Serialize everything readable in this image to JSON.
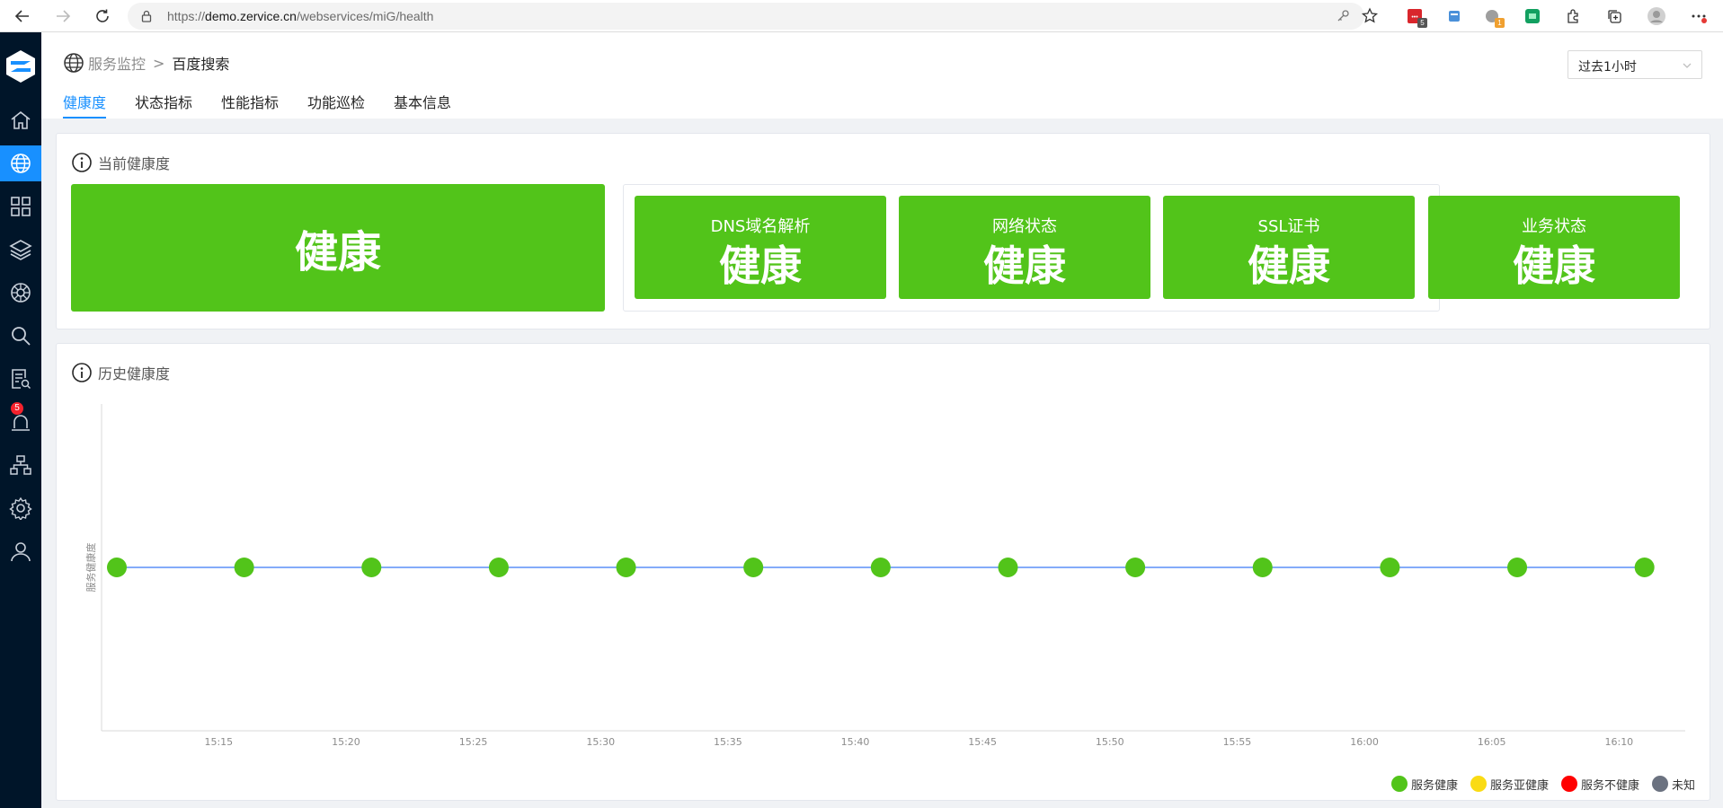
{
  "browser": {
    "url_prefix": "https://",
    "url_host": "demo.zervice.cn",
    "url_path": "/webservices/miG/health",
    "extension_badges": [
      "5",
      "1"
    ]
  },
  "sidebar": {
    "items": [
      {
        "name": "home",
        "icon": "home-icon",
        "active": false
      },
      {
        "name": "service-monitor",
        "icon": "globe-icon",
        "active": true
      },
      {
        "name": "apps",
        "icon": "grid-icon",
        "active": false
      },
      {
        "name": "layers",
        "icon": "layers-icon",
        "active": false
      },
      {
        "name": "cluster",
        "icon": "helm-icon",
        "active": false
      },
      {
        "name": "search",
        "icon": "search-icon",
        "active": false
      },
      {
        "name": "logs",
        "icon": "log-search-icon",
        "active": false
      },
      {
        "name": "alerts",
        "icon": "alarm-icon",
        "active": false,
        "badge": "5"
      },
      {
        "name": "topology",
        "icon": "topology-icon",
        "active": false
      },
      {
        "name": "settings",
        "icon": "gear-icon",
        "active": false
      },
      {
        "name": "user",
        "icon": "user-icon",
        "active": false
      }
    ]
  },
  "header": {
    "breadcrumb_parent": "服务监控",
    "breadcrumb_separator": ">",
    "breadcrumb_current": "百度搜索",
    "time_range": "过去1小时",
    "tabs": [
      {
        "label": "健康度",
        "active": true
      },
      {
        "label": "状态指标",
        "active": false
      },
      {
        "label": "性能指标",
        "active": false
      },
      {
        "label": "功能巡检",
        "active": false
      },
      {
        "label": "基本信息",
        "active": false
      }
    ]
  },
  "current_health": {
    "title": "当前健康度",
    "overall": "健康",
    "items": [
      {
        "label": "DNS域名解析",
        "status": "健康"
      },
      {
        "label": "网络状态",
        "status": "健康"
      },
      {
        "label": "SSL证书",
        "status": "健康"
      },
      {
        "label": "业务状态",
        "status": "健康"
      }
    ]
  },
  "history": {
    "title": "历史健康度"
  },
  "colors": {
    "healthy": "#52c41a",
    "sub_healthy": "#fadb14",
    "unhealthy": "#ff0000",
    "unknown": "#6b7280",
    "accent": "#1890ff",
    "sidebar_bg": "#001529"
  },
  "chart_data": {
    "type": "scatter",
    "title": "",
    "xlabel": "",
    "ylabel": "服务健康度",
    "x_ticks": [
      "15:15",
      "15:20",
      "15:25",
      "15:30",
      "15:35",
      "15:40",
      "15:45",
      "15:50",
      "15:55",
      "16:00",
      "16:05",
      "16:10"
    ],
    "xlim": [
      "15:11",
      "16:12"
    ],
    "series": [
      {
        "name": "服务健康",
        "color": "#52c41a",
        "x": [
          "15:11",
          "15:16",
          "15:21",
          "15:26",
          "15:31",
          "15:36",
          "15:41",
          "15:46",
          "15:51",
          "15:56",
          "16:01",
          "16:06",
          "16:11"
        ],
        "values": [
          "健康",
          "健康",
          "健康",
          "健康",
          "健康",
          "健康",
          "健康",
          "健康",
          "健康",
          "健康",
          "健康",
          "健康",
          "健康"
        ]
      }
    ],
    "legend": [
      {
        "label": "服务健康",
        "color": "#52c41a"
      },
      {
        "label": "服务亚健康",
        "color": "#fadb14"
      },
      {
        "label": "服务不健康",
        "color": "#ff0000"
      },
      {
        "label": "未知",
        "color": "#6b7280"
      }
    ],
    "legend_position": "bottom-right",
    "grid": false
  }
}
